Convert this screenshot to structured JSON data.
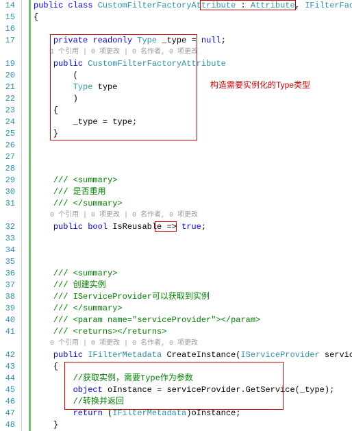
{
  "lines": {
    "start": 14,
    "end": 48
  },
  "code": {
    "l14": {
      "kw1": "public",
      "kw2": "class",
      "name": "CustomFilterFactoryAttribute",
      "colon": " : ",
      "base1": "Attribute",
      "comma": ", ",
      "base2": "IFilterFactory"
    },
    "l15": "{",
    "l17": {
      "kw1": "private",
      "kw2": "readonly",
      "type": "Type",
      "rest": " _type = ",
      "kw3": "null",
      "semi": ";"
    },
    "l18_lens": "1 个引用 | 0 项更改 | 0 名作者, 0 项更改",
    "l19": {
      "kw": "public",
      "name": " CustomFilterFactoryAttribute"
    },
    "l20": "(",
    "l21": {
      "type": "Type",
      "rest": " type"
    },
    "l22": ")",
    "l23": "{",
    "l24": "_type = type;",
    "l25": "}",
    "l29": {
      "c": "///",
      "rest": " <summary>"
    },
    "l30": {
      "c": "///",
      "rest": " 是否重用"
    },
    "l31": {
      "c": "///",
      "rest": " </summary>"
    },
    "l31_lens": "0 个引用 | 0 项更改 | 0 名作者, 0 项更改",
    "l32": {
      "kw1": "public",
      "kw2": "bool",
      "name": " IsReusable => ",
      "kw3": "true",
      "semi": ";"
    },
    "l36": {
      "c": "///",
      "rest": " <summary>"
    },
    "l37": {
      "c": "///",
      "rest": " 创建实例"
    },
    "l38": {
      "c": "///",
      "rest": " IServiceProvider可以获取到实例"
    },
    "l39": {
      "c": "///",
      "rest": " </summary>"
    },
    "l40": {
      "c": "///",
      "rest": " <param name=",
      "q": "\"serviceProvider\"",
      "rest2": "></param>"
    },
    "l41": {
      "c": "///",
      "rest": " <returns></returns>"
    },
    "l41_lens": "0 个引用 | 0 项更改 | 0 名作者, 0 项更改",
    "l42": {
      "kw": "public",
      "type": "IFilterMetadata",
      "name": " CreateInstance(",
      "type2": "IServiceProvider",
      "rest": " serviceProvider)"
    },
    "l43": "{",
    "l44": "//获取实例，需要Type作为参数",
    "l45": {
      "kw": "object",
      "rest": " oInstance = serviceProvider.GetService(_type);"
    },
    "l46": "//转换并返回",
    "l47": {
      "kw": "return",
      "rest": " (",
      "type": "IFilterMetadata",
      "rest2": ")oInstance;"
    },
    "l48": "}"
  },
  "annotation": "构造需要实例化的Type类型"
}
